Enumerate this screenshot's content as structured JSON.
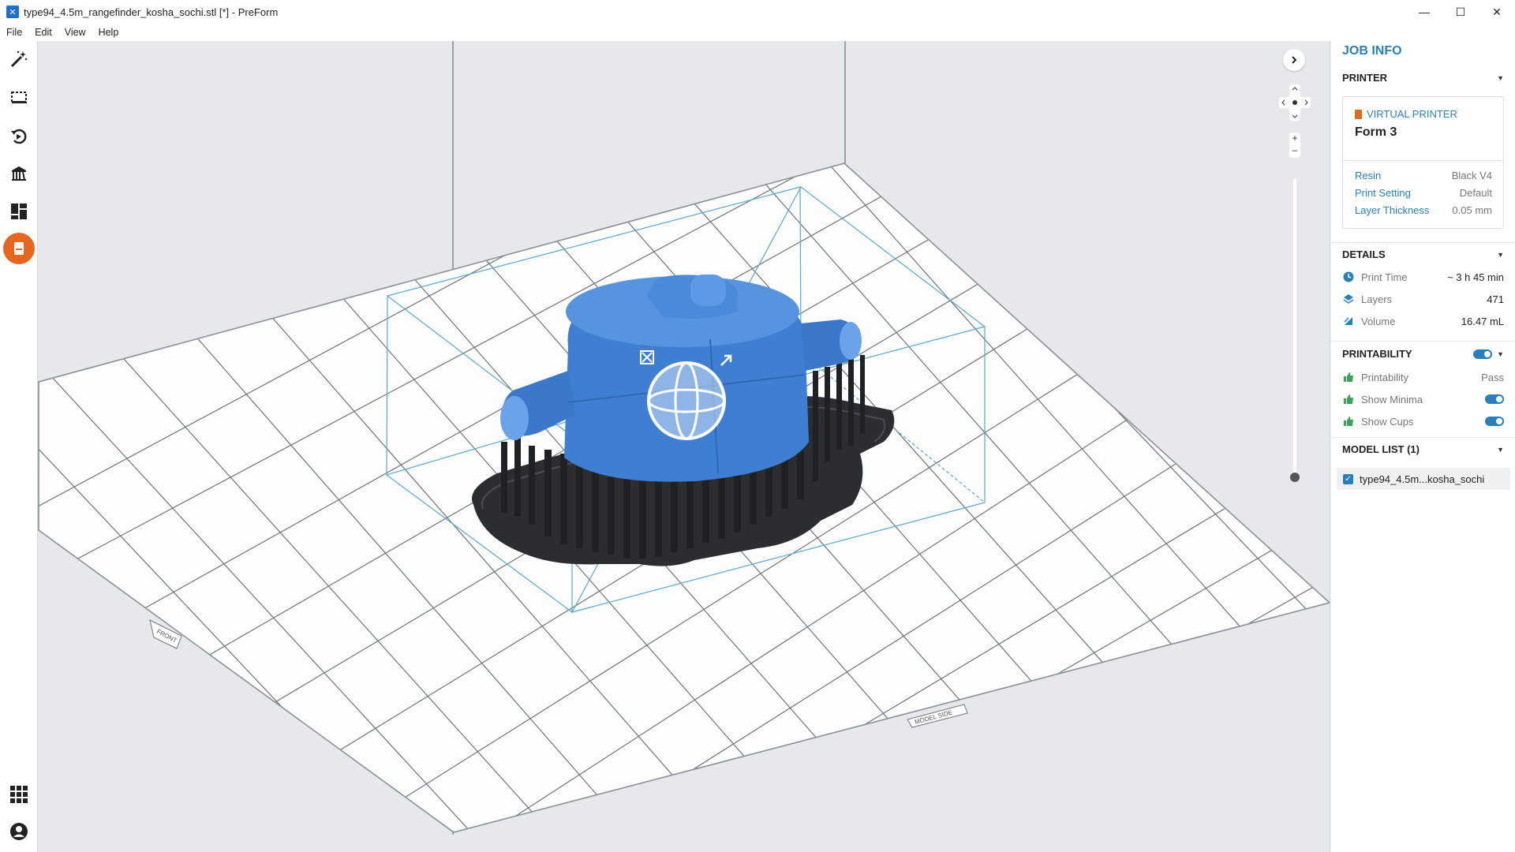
{
  "window": {
    "title": "type94_4.5m_rangefinder_kosha_sochi.stl [*] - PreForm",
    "app_icon": "preform-logo-icon",
    "controls": [
      "minimize",
      "maximize",
      "close"
    ]
  },
  "menu": [
    "File",
    "Edit",
    "View",
    "Help"
  ],
  "toolbar": {
    "tools": [
      "magic-wand-icon",
      "select-icon",
      "orient-icon",
      "supports-icon",
      "layout-icon",
      "printer-icon"
    ],
    "bottom": [
      "apps-grid-icon",
      "account-icon"
    ]
  },
  "viewport": {
    "build_plate_labels": [
      "FRONT",
      "MODEL SIDE"
    ]
  },
  "panel": {
    "title": "JOB INFO",
    "printer": {
      "header": "PRINTER",
      "virtual_label": "VIRTUAL PRINTER",
      "model": "Form 3",
      "resin_label": "Resin",
      "resin_value": "Black V4",
      "setting_label": "Print Setting",
      "setting_value": "Default",
      "thickness_label": "Layer Thickness",
      "thickness_value": "0.05 mm"
    },
    "details": {
      "header": "DETAILS",
      "print_time_label": "Print Time",
      "print_time_value": "~ 3 h 45 min",
      "layers_label": "Layers",
      "layers_value": "471",
      "volume_label": "Volume",
      "volume_value": "16.47 mL"
    },
    "printability": {
      "header": "PRINTABILITY",
      "printability_label": "Printability",
      "printability_value": "Pass",
      "minima_label": "Show Minima",
      "cups_label": "Show Cups"
    },
    "model_list": {
      "header": "MODEL LIST (1)",
      "item": "type94_4.5m...kosha_sochi"
    }
  },
  "colors": {
    "accent": "#2a7fb8",
    "model_blue": "#3e7fd3",
    "supports": "#2b2d30",
    "printer_orange": "#e8651f"
  }
}
